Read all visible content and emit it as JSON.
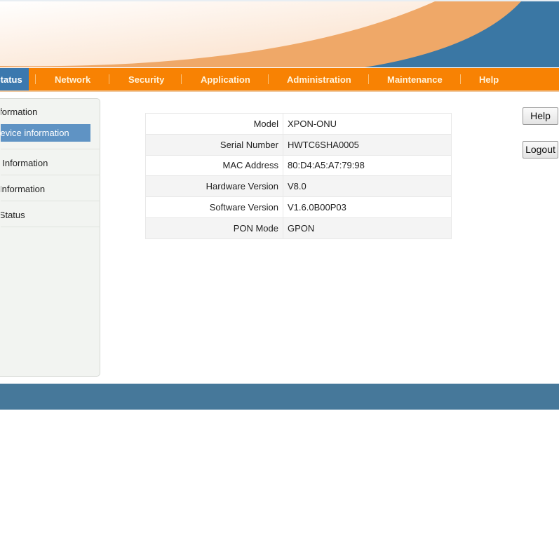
{
  "nav": {
    "tabs": [
      {
        "label": "Status",
        "active": true
      },
      {
        "label": "Network"
      },
      {
        "label": "Security"
      },
      {
        "label": "Application"
      },
      {
        "label": "Administration"
      },
      {
        "label": "Maintenance"
      },
      {
        "label": "Help"
      }
    ]
  },
  "sidebar": {
    "items": [
      {
        "label": "Device Information"
      },
      {
        "label": "Device information",
        "selected": true
      },
      {
        "label": "Network Information"
      },
      {
        "label": "User Information"
      },
      {
        "label": "PON Status"
      }
    ]
  },
  "device_info": {
    "rows": [
      {
        "label": "Model",
        "value": "XPON-ONU"
      },
      {
        "label": "Serial Number",
        "value": "HWTC6SHA0005"
      },
      {
        "label": "MAC Address",
        "value": "80:D4:A5:A7:79:98"
      },
      {
        "label": "Hardware Version",
        "value": "V8.0"
      },
      {
        "label": "Software Version",
        "value": "V1.6.0B00P03"
      },
      {
        "label": "PON Mode",
        "value": "GPON"
      }
    ]
  },
  "buttons": {
    "help": "Help",
    "logout": "Logout"
  },
  "colors": {
    "nav": "#f88203",
    "active_tab": "#3b78ae",
    "footer": "#46789a",
    "selected": "#5f93c4"
  }
}
